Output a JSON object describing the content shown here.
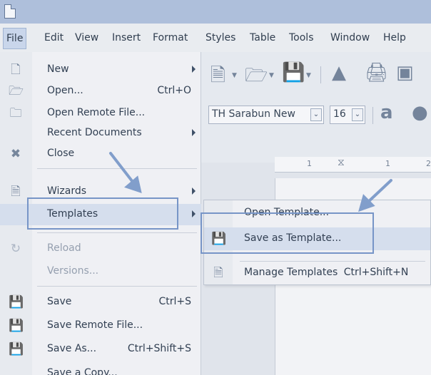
{
  "menubar": {
    "items": [
      {
        "label": "File",
        "left": 0
      },
      {
        "label": "Edit"
      },
      {
        "label": "View"
      },
      {
        "label": "Insert"
      },
      {
        "label": "Format"
      },
      {
        "label": "Styles"
      },
      {
        "label": "Table"
      },
      {
        "label": "Tools"
      },
      {
        "label": "Window"
      },
      {
        "label": "Help"
      }
    ]
  },
  "toolbar": {
    "font_name": "TH Sarabun New",
    "font_size": "16",
    "ruler_ticks": [
      "1",
      "1",
      "2"
    ]
  },
  "file_menu": {
    "items": [
      {
        "label": "New",
        "shortcut": "",
        "icon": "new-document-icon"
      },
      {
        "label": "Open...",
        "shortcut": "Ctrl+O",
        "icon": "open-folder-icon"
      },
      {
        "label": "Open Remote File...",
        "shortcut": "",
        "icon": "remote-open-icon"
      },
      {
        "label": "Recent Documents",
        "shortcut": "",
        "icon": ""
      },
      {
        "label": "Close",
        "shortcut": "",
        "icon": "close-icon"
      },
      {
        "label": "Wizards",
        "shortcut": "",
        "icon": "wizard-icon"
      },
      {
        "label": "Templates",
        "shortcut": "",
        "icon": ""
      },
      {
        "label": "Reload",
        "shortcut": "",
        "icon": "reload-icon"
      },
      {
        "label": "Versions...",
        "shortcut": "",
        "icon": ""
      },
      {
        "label": "Save",
        "shortcut": "Ctrl+S",
        "icon": "save-icon"
      },
      {
        "label": "Save Remote File...",
        "shortcut": "",
        "icon": "save-remote-icon"
      },
      {
        "label": "Save As...",
        "shortcut": "Ctrl+Shift+S",
        "icon": "save-as-icon"
      },
      {
        "label": "Save a Copy...",
        "shortcut": "",
        "icon": ""
      }
    ]
  },
  "templates_submenu": {
    "items": [
      {
        "label": "Open Template...",
        "shortcut": "",
        "icon": ""
      },
      {
        "label": "Save as Template...",
        "shortcut": "",
        "icon": "save-template-icon"
      },
      {
        "label": "Manage Templates",
        "shortcut": "Ctrl+Shift+N",
        "icon": "manage-templates-icon"
      }
    ]
  },
  "colors": {
    "titlebar": "#a9bcd9",
    "highlight": "#d3dcec",
    "callout": "#6f8fc4"
  }
}
